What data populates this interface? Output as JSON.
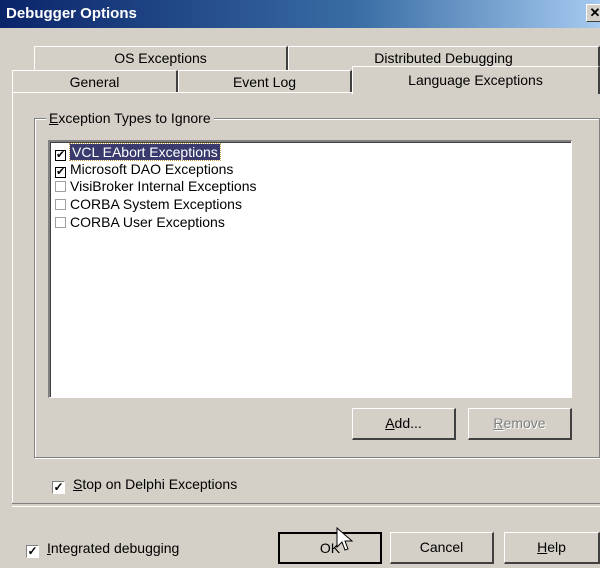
{
  "window": {
    "title": "Debugger Options",
    "close_glyph": "✕"
  },
  "tabs": {
    "row1": [
      {
        "label": "OS Exceptions"
      },
      {
        "label": "Distributed Debugging"
      }
    ],
    "row2": [
      {
        "label": "General"
      },
      {
        "label": "Event Log"
      },
      {
        "label": "Language Exceptions",
        "active": true
      }
    ]
  },
  "group": {
    "legend_pre": "",
    "legend_ul": "E",
    "legend_post": "xception Types to Ignore",
    "items": [
      {
        "label": "VCL EAbort Exceptions",
        "checked": true,
        "selected": true,
        "mark": "✔"
      },
      {
        "label": "Microsoft DAO Exceptions",
        "checked": true,
        "selected": false,
        "mark": "✔"
      },
      {
        "label": "VisiBroker Internal Exceptions",
        "checked": false,
        "selected": false,
        "mark": ""
      },
      {
        "label": "CORBA System Exceptions",
        "checked": false,
        "selected": false,
        "mark": ""
      },
      {
        "label": "CORBA User Exceptions",
        "checked": false,
        "selected": false,
        "mark": ""
      }
    ],
    "add_ul": "A",
    "add_post": "dd...",
    "remove_ul": "R",
    "remove_post": "emove"
  },
  "stop_on_delphi": {
    "checked": true,
    "mark": "✓",
    "ul": "S",
    "post": "top on Delphi Exceptions"
  },
  "integrated": {
    "checked": true,
    "mark": "✓",
    "ul": "I",
    "post": "ntegrated debugging"
  },
  "buttons": {
    "ok": "OK",
    "cancel": "Cancel",
    "help_ul": "H",
    "help_post": "elp"
  }
}
